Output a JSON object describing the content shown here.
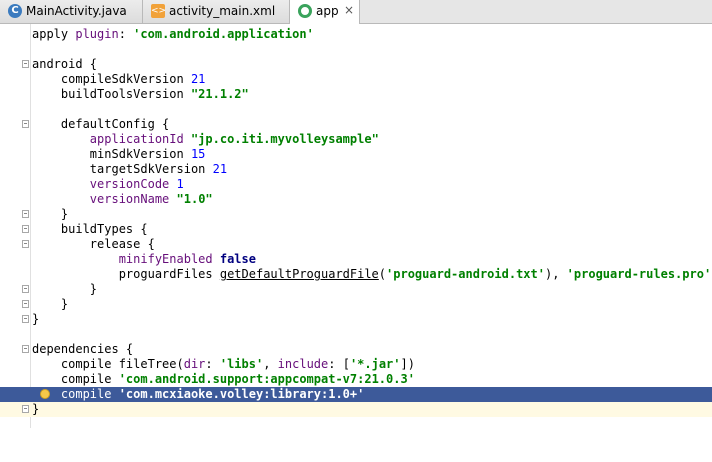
{
  "tabs": [
    {
      "label": "MainActivity.java",
      "icon": "java-class-icon",
      "active": false
    },
    {
      "label": "activity_main.xml",
      "icon": "xml-file-icon",
      "active": false
    },
    {
      "label": "app",
      "icon": "gradle-module-icon",
      "active": true
    }
  ],
  "code": {
    "l1": {
      "a": "apply ",
      "b": "plugin",
      "c": ": ",
      "d": "'com.android.application'"
    },
    "l3": {
      "a": "android {"
    },
    "l4": {
      "a": "    compileSdkVersion ",
      "b": "21"
    },
    "l5": {
      "a": "    buildToolsVersion ",
      "b": "\"21.1.2\""
    },
    "l7": {
      "a": "    defaultConfig {"
    },
    "l8": {
      "a": "        ",
      "b": "applicationId",
      "c": " ",
      "d": "\"jp.co.iti.myvolleysample\""
    },
    "l9": {
      "a": "        minSdkVersion ",
      "b": "15"
    },
    "l10": {
      "a": "        targetSdkVersion ",
      "b": "21"
    },
    "l11": {
      "a": "        ",
      "b": "versionCode",
      "c": " ",
      "d": "1"
    },
    "l12": {
      "a": "        ",
      "b": "versionName",
      "c": " ",
      "d": "\"1.0\""
    },
    "l13": {
      "a": "    }"
    },
    "l14": {
      "a": "    buildTypes {"
    },
    "l15": {
      "a": "        release {"
    },
    "l16": {
      "a": "            ",
      "b": "minifyEnabled",
      "c": " ",
      "d": "false"
    },
    "l17": {
      "a": "            proguardFiles ",
      "b": "getDefaultProguardFile",
      "c": "(",
      "d": "'proguard-android.txt'",
      "e": "), ",
      "f": "'proguard-rules.pro'"
    },
    "l18": {
      "a": "        }"
    },
    "l19": {
      "a": "    }"
    },
    "l20": {
      "a": "}"
    },
    "l22": {
      "a": "dependencies {"
    },
    "l23": {
      "a": "    compile fileTree(",
      "b": "dir",
      "c": ": ",
      "d": "'libs'",
      "e": ", ",
      "f": "include",
      "g": ": [",
      "h": "'*.jar'",
      "i": "])"
    },
    "l24": {
      "a": "    compile ",
      "b": "'com.android.support:appcompat-v7:21.0.3'"
    },
    "l25": {
      "a": "    compile ",
      "b": "'com.mcxiaoke.volley:library:1.0+'"
    },
    "l26": {
      "a": "}"
    }
  },
  "colors": {
    "selection": "#3d5a9a",
    "string": "#008000",
    "number": "#0000ff",
    "keyword": "#000080",
    "property": "#660e7a"
  }
}
